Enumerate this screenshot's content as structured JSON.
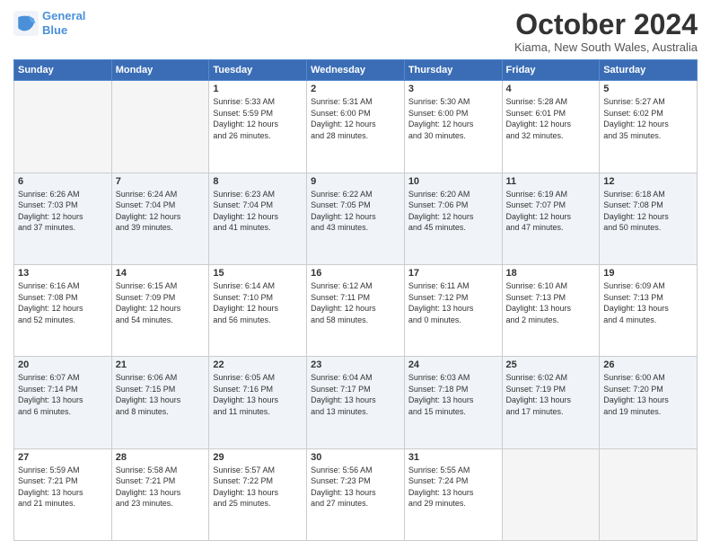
{
  "header": {
    "logo_line1": "General",
    "logo_line2": "Blue",
    "title": "October 2024",
    "subtitle": "Kiama, New South Wales, Australia"
  },
  "days_of_week": [
    "Sunday",
    "Monday",
    "Tuesday",
    "Wednesday",
    "Thursday",
    "Friday",
    "Saturday"
  ],
  "weeks": [
    [
      {
        "day": "",
        "info": ""
      },
      {
        "day": "",
        "info": ""
      },
      {
        "day": "1",
        "info": "Sunrise: 5:33 AM\nSunset: 5:59 PM\nDaylight: 12 hours\nand 26 minutes."
      },
      {
        "day": "2",
        "info": "Sunrise: 5:31 AM\nSunset: 6:00 PM\nDaylight: 12 hours\nand 28 minutes."
      },
      {
        "day": "3",
        "info": "Sunrise: 5:30 AM\nSunset: 6:00 PM\nDaylight: 12 hours\nand 30 minutes."
      },
      {
        "day": "4",
        "info": "Sunrise: 5:28 AM\nSunset: 6:01 PM\nDaylight: 12 hours\nand 32 minutes."
      },
      {
        "day": "5",
        "info": "Sunrise: 5:27 AM\nSunset: 6:02 PM\nDaylight: 12 hours\nand 35 minutes."
      }
    ],
    [
      {
        "day": "6",
        "info": "Sunrise: 6:26 AM\nSunset: 7:03 PM\nDaylight: 12 hours\nand 37 minutes."
      },
      {
        "day": "7",
        "info": "Sunrise: 6:24 AM\nSunset: 7:04 PM\nDaylight: 12 hours\nand 39 minutes."
      },
      {
        "day": "8",
        "info": "Sunrise: 6:23 AM\nSunset: 7:04 PM\nDaylight: 12 hours\nand 41 minutes."
      },
      {
        "day": "9",
        "info": "Sunrise: 6:22 AM\nSunset: 7:05 PM\nDaylight: 12 hours\nand 43 minutes."
      },
      {
        "day": "10",
        "info": "Sunrise: 6:20 AM\nSunset: 7:06 PM\nDaylight: 12 hours\nand 45 minutes."
      },
      {
        "day": "11",
        "info": "Sunrise: 6:19 AM\nSunset: 7:07 PM\nDaylight: 12 hours\nand 47 minutes."
      },
      {
        "day": "12",
        "info": "Sunrise: 6:18 AM\nSunset: 7:08 PM\nDaylight: 12 hours\nand 50 minutes."
      }
    ],
    [
      {
        "day": "13",
        "info": "Sunrise: 6:16 AM\nSunset: 7:08 PM\nDaylight: 12 hours\nand 52 minutes."
      },
      {
        "day": "14",
        "info": "Sunrise: 6:15 AM\nSunset: 7:09 PM\nDaylight: 12 hours\nand 54 minutes."
      },
      {
        "day": "15",
        "info": "Sunrise: 6:14 AM\nSunset: 7:10 PM\nDaylight: 12 hours\nand 56 minutes."
      },
      {
        "day": "16",
        "info": "Sunrise: 6:12 AM\nSunset: 7:11 PM\nDaylight: 12 hours\nand 58 minutes."
      },
      {
        "day": "17",
        "info": "Sunrise: 6:11 AM\nSunset: 7:12 PM\nDaylight: 13 hours\nand 0 minutes."
      },
      {
        "day": "18",
        "info": "Sunrise: 6:10 AM\nSunset: 7:13 PM\nDaylight: 13 hours\nand 2 minutes."
      },
      {
        "day": "19",
        "info": "Sunrise: 6:09 AM\nSunset: 7:13 PM\nDaylight: 13 hours\nand 4 minutes."
      }
    ],
    [
      {
        "day": "20",
        "info": "Sunrise: 6:07 AM\nSunset: 7:14 PM\nDaylight: 13 hours\nand 6 minutes."
      },
      {
        "day": "21",
        "info": "Sunrise: 6:06 AM\nSunset: 7:15 PM\nDaylight: 13 hours\nand 8 minutes."
      },
      {
        "day": "22",
        "info": "Sunrise: 6:05 AM\nSunset: 7:16 PM\nDaylight: 13 hours\nand 11 minutes."
      },
      {
        "day": "23",
        "info": "Sunrise: 6:04 AM\nSunset: 7:17 PM\nDaylight: 13 hours\nand 13 minutes."
      },
      {
        "day": "24",
        "info": "Sunrise: 6:03 AM\nSunset: 7:18 PM\nDaylight: 13 hours\nand 15 minutes."
      },
      {
        "day": "25",
        "info": "Sunrise: 6:02 AM\nSunset: 7:19 PM\nDaylight: 13 hours\nand 17 minutes."
      },
      {
        "day": "26",
        "info": "Sunrise: 6:00 AM\nSunset: 7:20 PM\nDaylight: 13 hours\nand 19 minutes."
      }
    ],
    [
      {
        "day": "27",
        "info": "Sunrise: 5:59 AM\nSunset: 7:21 PM\nDaylight: 13 hours\nand 21 minutes."
      },
      {
        "day": "28",
        "info": "Sunrise: 5:58 AM\nSunset: 7:21 PM\nDaylight: 13 hours\nand 23 minutes."
      },
      {
        "day": "29",
        "info": "Sunrise: 5:57 AM\nSunset: 7:22 PM\nDaylight: 13 hours\nand 25 minutes."
      },
      {
        "day": "30",
        "info": "Sunrise: 5:56 AM\nSunset: 7:23 PM\nDaylight: 13 hours\nand 27 minutes."
      },
      {
        "day": "31",
        "info": "Sunrise: 5:55 AM\nSunset: 7:24 PM\nDaylight: 13 hours\nand 29 minutes."
      },
      {
        "day": "",
        "info": ""
      },
      {
        "day": "",
        "info": ""
      }
    ]
  ]
}
